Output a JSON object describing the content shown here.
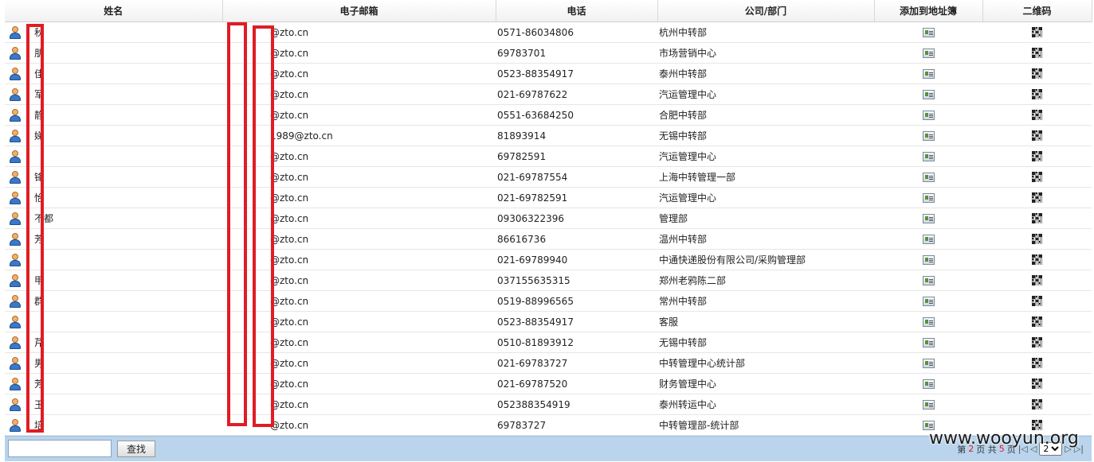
{
  "columns": [
    "姓名",
    "电子邮箱",
    "电话",
    "公司/部门",
    "添加到地址簿",
    "二维码"
  ],
  "rows": [
    {
      "name": "秋",
      "email": "@zto.cn",
      "phone": "0571-86034806",
      "dept": "杭州中转部"
    },
    {
      "name": "朋",
      "email": "@zto.cn",
      "phone": "69783701",
      "dept": "市场营销中心"
    },
    {
      "name": "佳",
      "email": "@zto.cn",
      "phone": "0523-88354917",
      "dept": "泰州中转部"
    },
    {
      "name": "军",
      "email": "@zto.cn",
      "phone": "021-69787622",
      "dept": "汽运管理中心"
    },
    {
      "name": "静",
      "email": "@zto.cn",
      "phone": "0551-63684250",
      "dept": "合肥中转部"
    },
    {
      "name": "娣",
      "email": "1989@zto.cn",
      "phone": "81893914",
      "dept": "无锡中转部"
    },
    {
      "name": "",
      "email": "@zto.cn",
      "phone": "69782591",
      "dept": "汽运管理中心"
    },
    {
      "name": "锋",
      "email": "@zto.cn",
      "phone": "021-69787554",
      "dept": "上海中转管理一部"
    },
    {
      "name": "怡",
      "email": "@zto.cn",
      "phone": "021-69782591",
      "dept": "汽运管理中心"
    },
    {
      "name": "不都",
      "email": "@zto.cn",
      "phone": "09306322396",
      "dept": "管理部"
    },
    {
      "name": "芳",
      "email": "@zto.cn",
      "phone": "86616736",
      "dept": "温州中转部"
    },
    {
      "name": "",
      "email": "@zto.cn",
      "phone": "021-69789940",
      "dept": "中通快递股份有限公司/采购管理部"
    },
    {
      "name": "甲",
      "email": "@zto.cn",
      "phone": "037155635315",
      "dept": "郑州老鸦陈二部"
    },
    {
      "name": "群",
      "email": "@zto.cn",
      "phone": "0519-88996565",
      "dept": "常州中转部"
    },
    {
      "name": "",
      "email": "@zto.cn",
      "phone": "0523-88354917",
      "dept": "客服"
    },
    {
      "name": "芹",
      "email": "@zto.cn",
      "phone": "0510-81893912",
      "dept": "无锡中转部"
    },
    {
      "name": "男",
      "email": "@zto.cn",
      "phone": "021-69783727",
      "dept": "中转管理中心统计部"
    },
    {
      "name": "芳",
      "email": "@zto.cn",
      "phone": "021-69787520",
      "dept": "财务管理中心"
    },
    {
      "name": "玉",
      "email": "@zto.cn",
      "phone": "052388354919",
      "dept": "泰州转运中心"
    },
    {
      "name": "培",
      "email": "@zto.cn",
      "phone": "69783727",
      "dept": "中转管理部-统计部"
    }
  ],
  "search": {
    "value": "",
    "button_label": "查找"
  },
  "pager": {
    "prefix": "第",
    "current": "2",
    "mid": "页 共",
    "total": "5",
    "suffix": "页",
    "selected": "2"
  },
  "watermark": "www.wooyun.org",
  "colors": {
    "header_bg": "#f1f1f1",
    "bottom_bar": "#b9d4ec",
    "redaction": "#e01c24"
  }
}
